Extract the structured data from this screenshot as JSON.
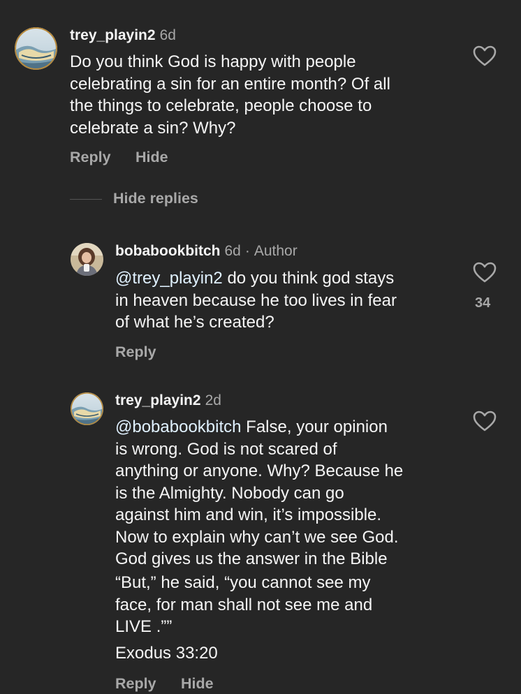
{
  "comment1": {
    "username": "trey_playin2",
    "time": "6d",
    "text": "Do you think God is happy with people\ncelebrating a sin for an entire month? Of all\nthe things to celebrate, people choose to\ncelebrate a sin? Why?",
    "reply_label": "Reply",
    "hide_label": "Hide"
  },
  "hide_replies_label": "Hide replies",
  "reply1": {
    "username": "bobabookbitch",
    "time": "6d",
    "separator": "·",
    "author_label": "Author",
    "mention": "@trey_playin2",
    "text_after_mention": " do you think god stays\nin heaven because he too lives in fear\nof what he’s created?",
    "like_count": "34",
    "reply_label": "Reply"
  },
  "reply2": {
    "username": "trey_playin2",
    "time": "2d",
    "mention": "@bobabookbitch",
    "text_after_mention": " False, your opinion\nis wrong. God is not scared of\nanything or anyone. Why? Because he\nis the Almighty. Nobody can go\nagainst him and win, it’s impossible.\nNow to explain why can’t we see God.\nGod gives us the answer in the Bible",
    "quote": "“But,” he said, “you cannot see my\nface, for man shall not see me and\nLIVE .””",
    "reference": "Exodus 33:20",
    "reply_label": "Reply",
    "hide_label": "Hide"
  },
  "icons": {
    "heart": "heart-outline-icon"
  },
  "colors": {
    "background": "#262626",
    "text": "#f5f5f5",
    "secondary": "#a8a8a8",
    "mention": "#e0f1ff"
  }
}
